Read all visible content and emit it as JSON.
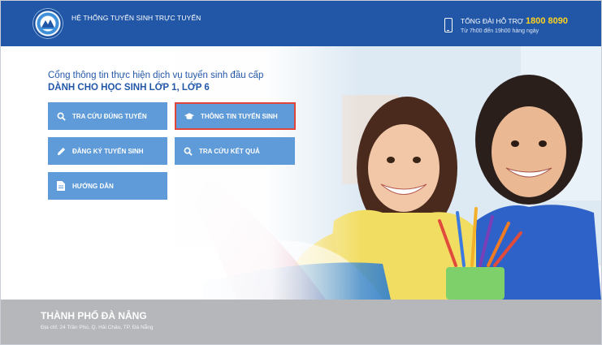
{
  "header": {
    "site_title": "HỆ THỐNG TUYỂN SINH TRỰC TUYẾN",
    "hotline_label": "TỔNG ĐÀI HỖ TRỢ",
    "hotline_number": "1800 8090",
    "hotline_hours": "Từ 7h00 đến 19h00 hàng ngày",
    "logo_icon": "city-logo-icon",
    "phone_icon": "phone-icon"
  },
  "hero": {
    "intro_line1": "Cổng thông tin thực hiện dịch vụ tuyển sinh đầu cấp",
    "intro_line2": "DÀNH CHO HỌC SINH LỚP 1, LỚP 6",
    "image": "two-smiling-schoolgirls-with-colored-pencils"
  },
  "buttons": [
    {
      "label": "TRA CỨU ĐÚNG TUYẾN",
      "icon": "search-icon",
      "active": false
    },
    {
      "label": "THÔNG TIN TUYỂN SINH",
      "icon": "graduation-cap-icon",
      "active": true
    },
    {
      "label": "ĐĂNG KÝ TUYỂN SINH",
      "icon": "pencil-icon",
      "active": false
    },
    {
      "label": "TRA CỨU KẾT QUẢ",
      "icon": "search-icon",
      "active": false
    },
    {
      "label": "HƯỚNG DẪN",
      "icon": "document-icon",
      "active": false
    }
  ],
  "footer": {
    "city": "THÀNH PHỐ ĐÀ NẴNG",
    "address": "Địa chỉ: 24 Trần Phú, Q. Hải Châu, TP. Đà Nẵng"
  },
  "colors": {
    "header_bg": "#2257a8",
    "button_bg": "#5f9bd8",
    "active_border": "#e0453a",
    "hotline_number": "#ffd21e",
    "footer_bg": "#b5b7ba"
  }
}
